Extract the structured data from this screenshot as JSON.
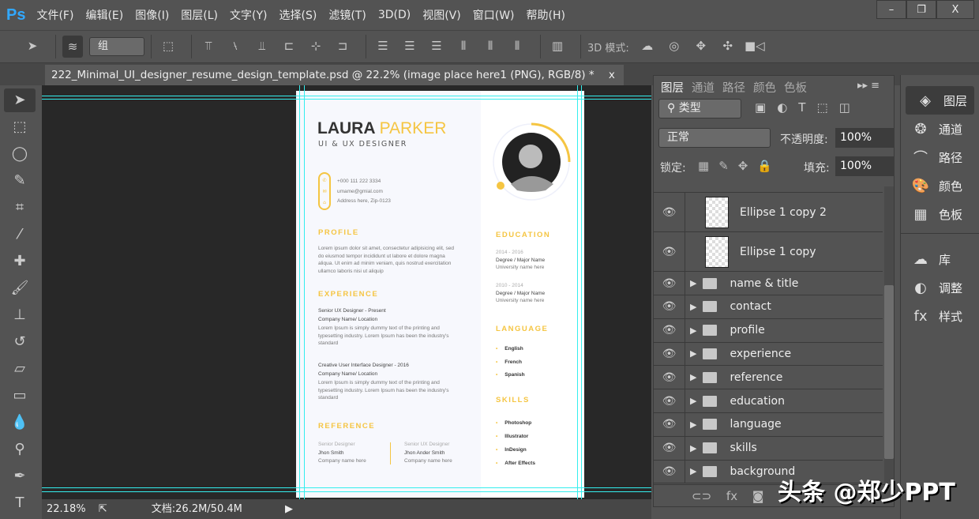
{
  "app": {
    "logo": "Ps"
  },
  "menu": [
    "文件(F)",
    "编辑(E)",
    "图像(I)",
    "图层(L)",
    "文字(Y)",
    "选择(S)",
    "滤镜(T)",
    "3D(D)",
    "视图(V)",
    "窗口(W)",
    "帮助(H)"
  ],
  "window_buttons": {
    "minimize": "–",
    "restore": "❐",
    "close": "X"
  },
  "options": {
    "group_select": "组",
    "mode3d_label": "3D 模式:"
  },
  "document_tab": {
    "title": "222_Minimal_UI_designer_resume_design_template.psd @ 22.2% (image place here1 (PNG), RGB/8) *",
    "close": "x"
  },
  "status": {
    "zoom": "22.18%",
    "doc_size": "文档:26.2M/50.4M"
  },
  "resume": {
    "first_name": "LAURA",
    "last_name": "PARKER",
    "role": "UI & UX DESIGNER",
    "contact": [
      "+000 111 222 3334",
      "umame@gmial.com",
      "Address here, Zip-0123"
    ],
    "profile_title": "PROFILE",
    "profile_text": "Lorem ipsum dolor sit amet, consectetur adipisicing elit, sed do eiusmod tempor incididunt ut labore et dolore magna aliqua. Ut enim ad minim veniam, quis nostrud exercitation ullamco laboris nisi ut aliquip",
    "experience_title": "EXPERIENCE",
    "experience": [
      {
        "role": "Senior UX Designer - Present",
        "company": "Company Name/ Location",
        "text": "Lorem Ipsum is simply dummy text of the printing and typesetting industry. Lorem Ipsum has been the industry's standard"
      },
      {
        "role": "Creative User Interface Designer - 2016",
        "company": "Company Name/ Location",
        "text": "Lorem Ipsum is simply dummy text of the printing and typesetting industry. Lorem Ipsum has been the industry's standard"
      }
    ],
    "reference_title": "REFERENCE",
    "references": [
      {
        "title": "Senior Designer",
        "name": "Jhon Smith",
        "company": "Company name here"
      },
      {
        "title": "Senior UX Designer",
        "name": "Jhon Ander Smith",
        "company": "Company name here"
      }
    ],
    "education_title": "EDUCATION",
    "education": [
      {
        "years": "2014 - 2016",
        "degree": "Degree / Major Name",
        "school": "University name here"
      },
      {
        "years": "2010 - 2014",
        "degree": "Degree / Major Name",
        "school": "University name here"
      }
    ],
    "language_title": "LANGUAGE",
    "languages": [
      "English",
      "French",
      "Spanish"
    ],
    "skills_title": "SKILLS",
    "skills": [
      "Photoshop",
      "Illustrator",
      "InDesign",
      "After Effects"
    ],
    "accent": "#f5c542"
  },
  "layers_panel": {
    "tabs": [
      "图层",
      "通道",
      "路径",
      "颜色",
      "色板"
    ],
    "filter": "类型",
    "blend": "正常",
    "opacity_label": "不透明度:",
    "opacity": "100%",
    "lock_label": "锁定:",
    "fill_label": "填充:",
    "fill": "100%",
    "layers": [
      "Ellipse 1 copy 2",
      "Ellipse 1 copy"
    ],
    "groups": [
      "name & title",
      "contact",
      "profile",
      "experience",
      "reference",
      "education",
      "language",
      "skills",
      "background"
    ]
  },
  "dock": [
    "图层",
    "通道",
    "路径",
    "颜色",
    "色板",
    "库",
    "调整",
    "样式"
  ],
  "watermark": "头条 @郑少PPT"
}
